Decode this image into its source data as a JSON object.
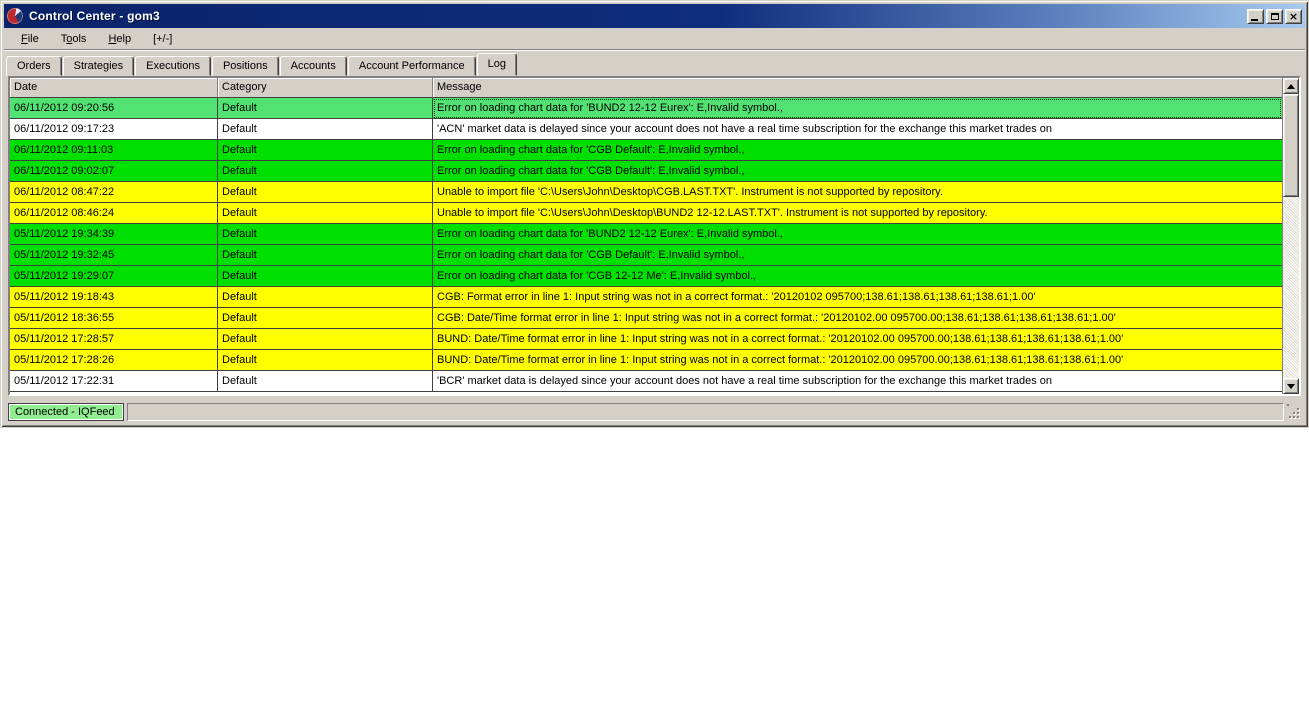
{
  "window": {
    "title": "Control Center - gom3",
    "icon": "ninjatrader-logo",
    "controls": {
      "minimize": "minimize",
      "maximize": "maximize",
      "close": "close"
    }
  },
  "menu": {
    "items": [
      {
        "id": "file",
        "label": "File",
        "underline": 0
      },
      {
        "id": "tools",
        "label": "Tools",
        "underline": 1
      },
      {
        "id": "help",
        "label": "Help",
        "underline": 0
      },
      {
        "id": "expand",
        "label": "[+/-]",
        "underline": -1
      }
    ]
  },
  "tabs": [
    {
      "id": "orders",
      "label": "Orders",
      "active": false
    },
    {
      "id": "strategies",
      "label": "Strategies",
      "active": false
    },
    {
      "id": "executions",
      "label": "Executions",
      "active": false
    },
    {
      "id": "positions",
      "label": "Positions",
      "active": false
    },
    {
      "id": "accounts",
      "label": "Accounts",
      "active": false
    },
    {
      "id": "account-performance",
      "label": "Account Performance",
      "active": false
    },
    {
      "id": "log",
      "label": "Log",
      "active": true
    }
  ],
  "log_table": {
    "columns": [
      "Date",
      "Category",
      "Message"
    ],
    "rows": [
      {
        "date": "06/11/2012 09:20:56",
        "category": "Default",
        "message": "Error on loading chart data for 'BUND2 12-12 Eurex': E,Invalid symbol.,",
        "color": "green",
        "selected": true
      },
      {
        "date": "06/11/2012 09:17:23",
        "category": "Default",
        "message": "'ACN' market data is delayed since your account does not have a real time subscription for the exchange this market trades on",
        "color": "white",
        "selected": false
      },
      {
        "date": "06/11/2012 09:11:03",
        "category": "Default",
        "message": "Error on loading chart data for 'CGB Default': E,Invalid symbol.,",
        "color": "green",
        "selected": false
      },
      {
        "date": "06/11/2012 09:02:07",
        "category": "Default",
        "message": "Error on loading chart data for 'CGB Default': E,Invalid symbol.,",
        "color": "green",
        "selected": false
      },
      {
        "date": "06/11/2012 08:47:22",
        "category": "Default",
        "message": "Unable to import file 'C:\\Users\\John\\Desktop\\CGB.LAST.TXT'. Instrument is not supported by repository.",
        "color": "yellow",
        "selected": false
      },
      {
        "date": "06/11/2012 08:46:24",
        "category": "Default",
        "message": "Unable to import file 'C:\\Users\\John\\Desktop\\BUND2 12-12.LAST.TXT'. Instrument is not supported by repository.",
        "color": "yellow",
        "selected": false
      },
      {
        "date": "05/11/2012 19:34:39",
        "category": "Default",
        "message": "Error on loading chart data for 'BUND2 12-12 Eurex': E,Invalid symbol.,",
        "color": "green",
        "selected": false
      },
      {
        "date": "05/11/2012 19:32:45",
        "category": "Default",
        "message": "Error on loading chart data for 'CGB Default': E,Invalid symbol.,",
        "color": "green",
        "selected": false
      },
      {
        "date": "05/11/2012 19:29:07",
        "category": "Default",
        "message": "Error on loading chart data for 'CGB 12-12 Me': E,Invalid symbol.,",
        "color": "green",
        "selected": false
      },
      {
        "date": "05/11/2012 19:18:43",
        "category": "Default",
        "message": "CGB: Format error in line 1: Input string was not in a correct format.: '20120102 095700;138.61;138.61;138.61;138.61;1.00'",
        "color": "yellow",
        "selected": false
      },
      {
        "date": "05/11/2012 18:36:55",
        "category": "Default",
        "message": "CGB: Date/Time format error in line 1: Input string was not in a correct format.: '20120102.00 095700.00;138.61;138.61;138.61;138.61;1.00'",
        "color": "yellow",
        "selected": false
      },
      {
        "date": "05/11/2012 17:28:57",
        "category": "Default",
        "message": "BUND: Date/Time format error in line 1: Input string was not in a correct format.: '20120102.00 095700.00;138.61;138.61;138.61;138.61;1.00'",
        "color": "yellow",
        "selected": false
      },
      {
        "date": "05/11/2012 17:28:26",
        "category": "Default",
        "message": "BUND: Date/Time format error in line 1: Input string was not in a correct format.: '20120102.00 095700.00;138.61;138.61;138.61;138.61;1.00'",
        "color": "yellow",
        "selected": false
      },
      {
        "date": "05/11/2012 17:22:31",
        "category": "Default",
        "message": "'BCR' market data is delayed since your account does not have a real time subscription for the exchange this market trades on",
        "color": "white",
        "selected": false
      }
    ]
  },
  "status_bar": {
    "connection": "Connected - IQFeed"
  },
  "colors": {
    "row_green": "#00e000",
    "row_green_selected": "#52e272",
    "row_yellow": "#ffff00",
    "row_white": "#ffffff",
    "status_chip_green": "#90ee90",
    "titlebar_left": "#0a246a",
    "titlebar_right": "#a6caf0",
    "chrome_gray": "#d4d0c8"
  }
}
